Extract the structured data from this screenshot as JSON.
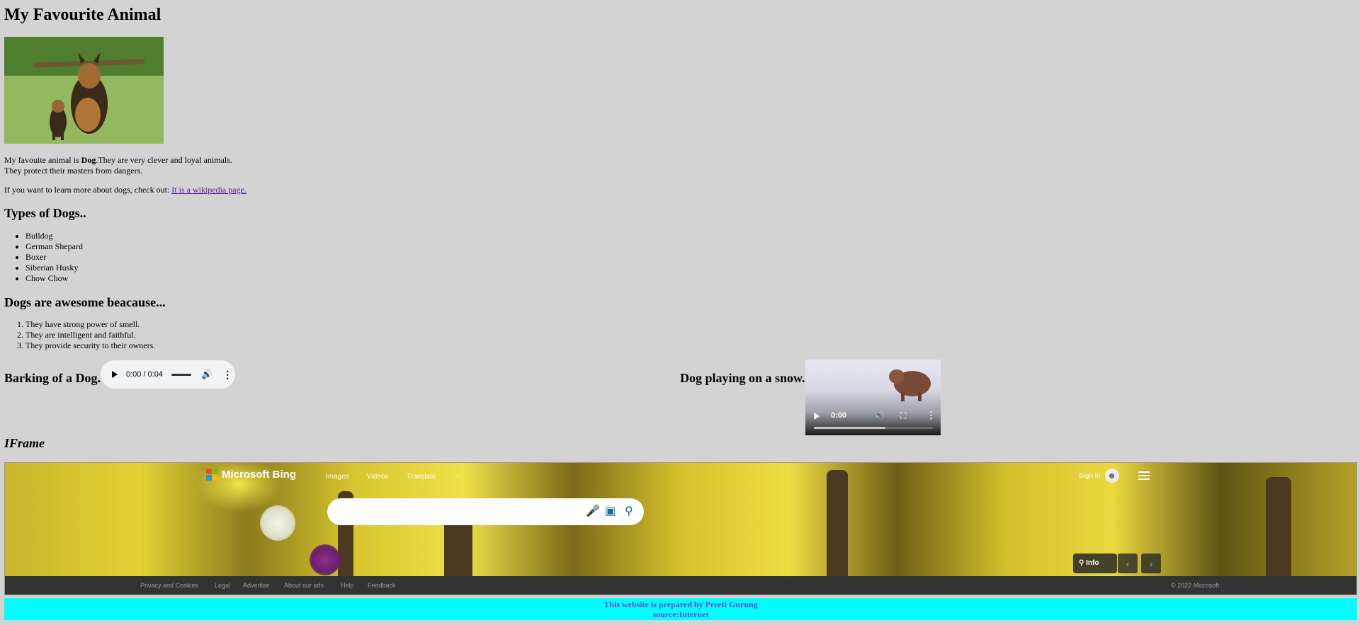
{
  "page": {
    "title": "My Favourite Animal",
    "intro_prefix": "My favouite animal is ",
    "intro_bold": "Dog",
    "intro_suffix": ".They are very clever and loyal animals.",
    "intro_line2": "They protect their masters from dangers.",
    "learn_text": "If you want to learn more about dogs, check out: ",
    "learn_link": "It is a wikipedia page."
  },
  "types": {
    "heading": "Types of Dogs..",
    "items": [
      "Bulldog",
      "German Shepard",
      "Boxer",
      "Siberian Husky",
      "Chow Chow"
    ]
  },
  "reasons": {
    "heading": "Dogs are awesome beacause...",
    "items": [
      "They have strong power of smell.",
      "They are intelligent and faithful.",
      "They provide security to their owners."
    ]
  },
  "audio": {
    "label": "Barking of a Dog.",
    "time": "0:00 / 0:04",
    "icons": [
      "play-icon",
      "volume-icon",
      "more-vert-icon"
    ]
  },
  "video": {
    "label": "Dog playing on a snow.",
    "time": "0:00",
    "progress": 0.6,
    "icons": [
      "play-icon",
      "volume-icon",
      "fullscreen-icon",
      "more-vert-icon"
    ]
  },
  "iframe": {
    "heading": "IFrame",
    "bing": {
      "brand": "Microsoft Bing",
      "nav": [
        "Images",
        "Videos",
        "Translate",
        "···"
      ],
      "signin": "Sign in",
      "info": "Info",
      "footer_links": [
        "Privacy and Cookies",
        "Legal",
        "Advertise",
        "About our ads",
        "Help",
        "Feedback"
      ],
      "copyright": "© 2022 Microsoft",
      "logo_colors": [
        "#f25022",
        "#7fba00",
        "#00a4ef",
        "#ffb900"
      ]
    }
  },
  "footer": {
    "line1": "This website is prepared by Preeti Gurung",
    "line2": "source:Internet",
    "bg": "#00ffff",
    "color": "#7b3fd9"
  }
}
